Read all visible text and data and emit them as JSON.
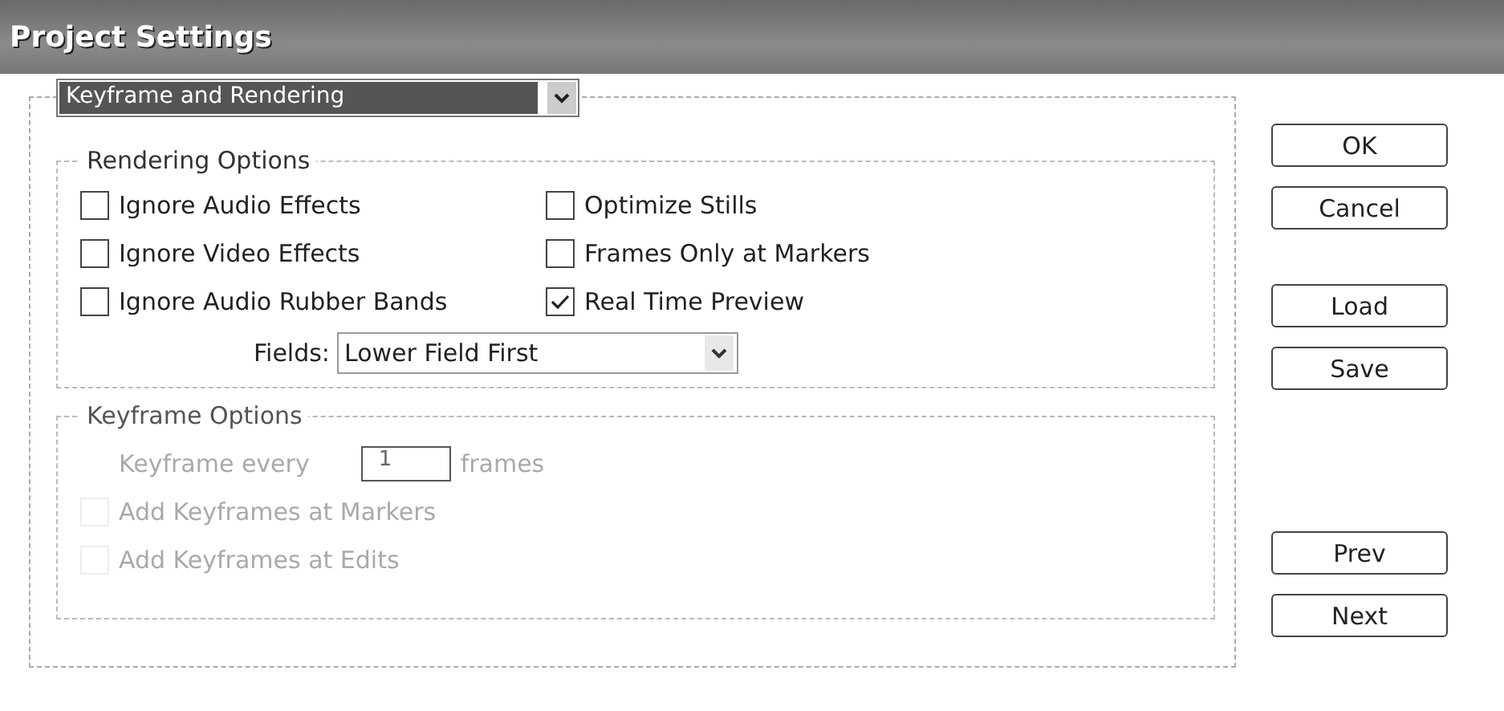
{
  "window": {
    "title": "Project Settings"
  },
  "section_select": {
    "value": "Keyframe and Rendering"
  },
  "rendering_options": {
    "title": "Rendering Options",
    "checkboxes": [
      {
        "label": "Ignore Audio Effects",
        "checked": false
      },
      {
        "label": "Optimize Stills",
        "checked": false
      },
      {
        "label": "Ignore Video Effects",
        "checked": false
      },
      {
        "label": "Frames Only at Markers",
        "checked": false
      },
      {
        "label": "Ignore Audio Rubber Bands",
        "checked": false
      },
      {
        "label": "Real Time Preview",
        "checked": true
      }
    ],
    "fields": {
      "label": "Fields:",
      "value": "Lower Field First"
    }
  },
  "keyframe_options": {
    "title": "Keyframe Options",
    "disabled": true,
    "keyframe_every": {
      "label": "Keyframe every",
      "value": "1",
      "unit": "frames"
    },
    "checkboxes": [
      {
        "label": "Add Keyframes at Markers",
        "checked": false
      },
      {
        "label": "Add Keyframes at Edits",
        "checked": false
      }
    ]
  },
  "button_groups": [
    [
      "OK",
      "Cancel"
    ],
    [
      "Load",
      "Save"
    ],
    [
      "Prev",
      "Next"
    ]
  ]
}
